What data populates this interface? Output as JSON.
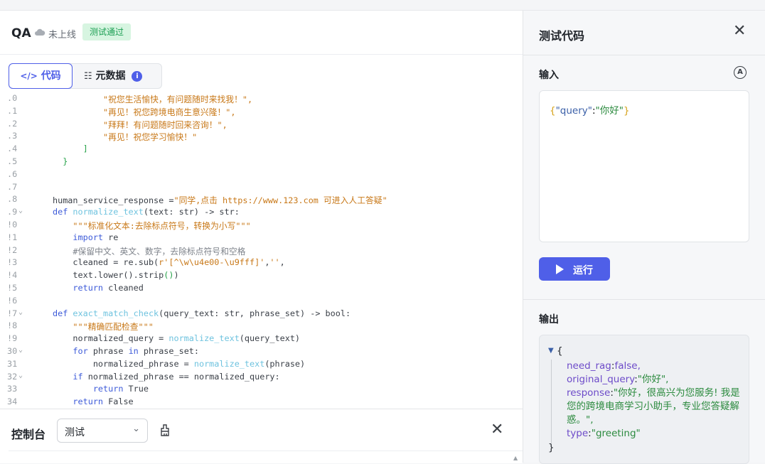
{
  "header": {
    "title": "QA",
    "status": "未上线",
    "badge": "测试通过"
  },
  "tabs": {
    "code": "代码",
    "metadata": "元数据",
    "info_glyph": "i"
  },
  "code_lines": [
    {
      "no": ".0",
      "html": "<span class=\"str\">          \"祝您生活愉快，有问题随时来找我！\",</span>"
    },
    {
      "no": ".1",
      "html": "<span class=\"str\">          \"再见！祝您跨境电商生意兴隆！\",</span>"
    },
    {
      "no": ".2",
      "html": "<span class=\"str\">          \"拜拜！有问题随时回来咨询！\",</span>"
    },
    {
      "no": ".3",
      "html": "<span class=\"str\">          \"再见！祝您学习愉快！\"</span>"
    },
    {
      "no": ".4",
      "html": "<span class=\"br\">      ]</span>"
    },
    {
      "no": ".5",
      "html": "<span class=\"br\">  }</span>"
    },
    {
      "no": ".6",
      "html": ""
    },
    {
      "no": ".7",
      "html": ""
    },
    {
      "no": ".8",
      "html": "human_service_response =<span class=\"str\">\"同学,点击 https://www.123.com 可进入人工答疑\"</span>"
    },
    {
      "no": ".9",
      "fold": true,
      "html": "<span class=\"kw\">def</span> <span class=\"fn\">normalize_text</span>(text: str) -> str:"
    },
    {
      "no": "!0",
      "html": "    <span class=\"str\">\"\"\"标准化文本:去除标点符号，转换为小写\"\"\"</span>"
    },
    {
      "no": "!1",
      "html": "    <span class=\"kw\">import</span> re"
    },
    {
      "no": "!2",
      "html": "    <span class=\"cm\">#保留中文、英文、数字，去除标点符号和空格</span>"
    },
    {
      "no": "!3",
      "html": "    cleaned = re.sub(<span class=\"str\">r'[^\\w\\u4e00-\\u9fff]'</span>,<span class=\"str\">''</span>,"
    },
    {
      "no": "!4",
      "html": "    text.lower().strip<span class=\"br\">()</span>)"
    },
    {
      "no": "!5",
      "html": "    <span class=\"kw\">return</span> cleaned"
    },
    {
      "no": "!6",
      "html": ""
    },
    {
      "no": "!7",
      "fold": true,
      "html": "<span class=\"kw\">def</span> <span class=\"fn\">exact_match_check</span>(query_text: str, phrase_set) -> bool:"
    },
    {
      "no": "!8",
      "html": "    <span class=\"str\">\"\"\"精确匹配检查\"\"\"</span>"
    },
    {
      "no": "!9",
      "html": "    normalized_query = <span class=\"fn\">normalize_text</span>(query_text)"
    },
    {
      "no": "30",
      "fold": true,
      "html": "    <span class=\"kw\">for</span> phrase <span class=\"kw\">in</span> phrase_set:"
    },
    {
      "no": "31",
      "html": "        normalized_phrase = <span class=\"fn\">normalize_text</span>(phrase)"
    },
    {
      "no": "32",
      "fold": true,
      "html": "    <span class=\"kw\">if</span> normalized_phrase == normalized_query:"
    },
    {
      "no": "33",
      "html": "        <span class=\"kw\">return</span> True"
    },
    {
      "no": "34",
      "html": "    <span class=\"kw\">return</span> False"
    }
  ],
  "console": {
    "label": "控制台",
    "select_value": "测试"
  },
  "panel": {
    "title": "测试代码",
    "input_label": "输入",
    "input_json": {
      "open": "{",
      "key": "\"query\"",
      "colon": ":",
      "value": "\"你好\"",
      "close": "}"
    },
    "run_label": "运行",
    "output_label": "输出",
    "output": {
      "open": "{",
      "close": "}",
      "fields": [
        {
          "key": "need_rag",
          "value": "false,"
        },
        {
          "key": "original_query",
          "value": "\"你好\","
        },
        {
          "key": "response",
          "value": "\"你好，很高兴为您服务! 我是您的跨境电商学习小助手，专业您答疑解惑。\","
        },
        {
          "key": "type",
          "value": "\"greeting\""
        }
      ]
    }
  },
  "colors": {
    "accent": "#4f5fe8",
    "badge_bg": "#d7f5e1",
    "badge_fg": "#1a9e52"
  }
}
